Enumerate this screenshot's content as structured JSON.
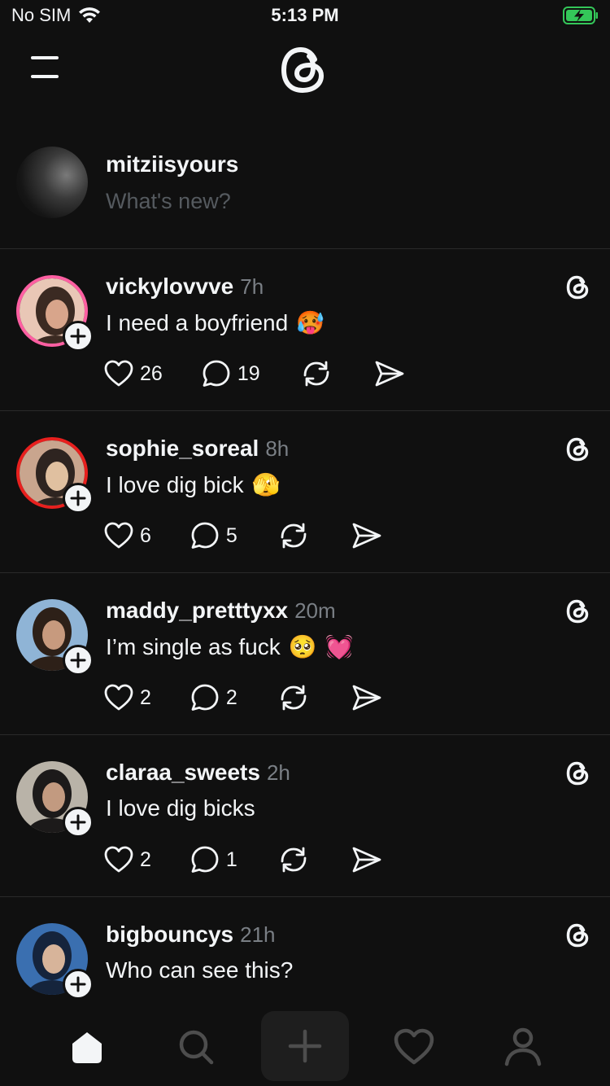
{
  "status_bar": {
    "carrier": "No SIM",
    "time": "5:13 PM",
    "battery_color": "#34c759"
  },
  "composer": {
    "username": "mitziisyours",
    "placeholder": "What's new?"
  },
  "posts": [
    {
      "username": "vickylovvve",
      "time": "7h",
      "text": "I need a boyfriend",
      "emojis": [
        "🥵"
      ],
      "likes": "26",
      "replies": "19",
      "avatar_ring": "#ff5fa2"
    },
    {
      "username": "sophie_soreal",
      "time": "8h",
      "text": "I love dig bick",
      "emojis": [
        "🫣"
      ],
      "likes": "6",
      "replies": "5",
      "avatar_ring": "#e8201e"
    },
    {
      "username": "maddy_pretttyxx",
      "time": "20m",
      "text": "I’m single as fuck",
      "emojis": [
        "🥺",
        "💓"
      ],
      "likes": "2",
      "replies": "2",
      "avatar_ring": ""
    },
    {
      "username": "claraa_sweets",
      "time": "2h",
      "text": "I love dig bicks",
      "emojis": [],
      "likes": "2",
      "replies": "1",
      "avatar_ring": ""
    },
    {
      "username": "bigbouncys",
      "time": "21h",
      "text": "Who can see this?",
      "emojis": [],
      "likes": "",
      "replies": "",
      "avatar_ring": ""
    }
  ],
  "nav": {
    "items": [
      "home-icon",
      "search-icon",
      "create-icon",
      "activity-heart-icon",
      "profile-icon"
    ],
    "active": "home-icon"
  }
}
